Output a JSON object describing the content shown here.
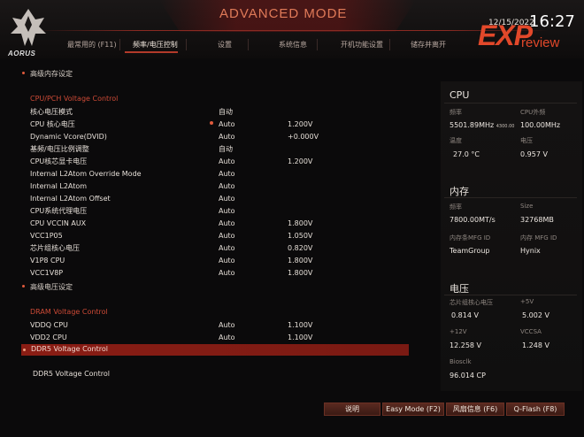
{
  "header": {
    "mode_title": "ADVANCED MODE",
    "logo_text": "AORUS",
    "date": "12/15/2022",
    "time": "16:27",
    "exp_logo": "EXP",
    "review_logo": "review",
    "tabs": [
      {
        "label": "最常用的 (F11)",
        "active": false
      },
      {
        "label": "频率/电压控制",
        "active": true
      },
      {
        "label": "设置",
        "active": false
      },
      {
        "label": "系统信息",
        "active": false
      },
      {
        "label": "开机功能设置",
        "active": false
      },
      {
        "label": "储存并离开",
        "active": false
      }
    ]
  },
  "menu": {
    "top_item": "高级内存设定",
    "cpu_section_title": "CPU/PCH Voltage Control",
    "rows": [
      {
        "label": "核心电压模式",
        "value": "自动",
        "value2": ""
      },
      {
        "label": "CPU 核心电压",
        "value": "Auto",
        "value2": "1.200V"
      },
      {
        "label": "Dynamic Vcore(DVID)",
        "value": "Auto",
        "value2": "+0.000V"
      },
      {
        "label": "基频/电压比例调整",
        "value": "自动",
        "value2": ""
      },
      {
        "label": "CPU核芯显卡电压",
        "value": "Auto",
        "value2": "1.200V"
      },
      {
        "label": "Internal L2Atom Override Mode",
        "value": "Auto",
        "value2": ""
      },
      {
        "label": "Internal L2Atom",
        "value": "Auto",
        "value2": ""
      },
      {
        "label": "Internal L2Atom Offset",
        "value": "Auto",
        "value2": ""
      },
      {
        "label": "CPU系统代理电压",
        "value": "Auto",
        "value2": ""
      },
      {
        "label": "CPU VCCIN AUX",
        "value": "Auto",
        "value2": "1.800V"
      },
      {
        "label": "VCC1P05",
        "value": "Auto",
        "value2": "1.050V"
      },
      {
        "label": "芯片组核心电压",
        "value": "Auto",
        "value2": "0.820V"
      },
      {
        "label": "V1P8 CPU",
        "value": "Auto",
        "value2": "1.800V"
      },
      {
        "label": "VCC1V8P",
        "value": "Auto",
        "value2": "1.800V"
      }
    ],
    "advanced_voltage": "高级电压设定",
    "dram_section_title": "DRAM Voltage Control",
    "dram_rows": [
      {
        "label": "VDDQ CPU",
        "value": "Auto",
        "value2": "1.100V"
      },
      {
        "label": "VDD2 CPU",
        "value": "Auto",
        "value2": "1.100V"
      }
    ],
    "ddr5_highlight": "DDR5 Voltage Control",
    "ddr5_bottom": "DDR5 Voltage Control"
  },
  "right_panel": {
    "cpu": {
      "title": "CPU",
      "freq_label": "频率",
      "freq_value": "5501.89MHz",
      "freq_sub": "4300.00",
      "ext_freq_label": "CPU外频",
      "ext_freq_value": "100.00MHz",
      "temp_label": "温度",
      "temp_value": "27.0 °C",
      "voltage_label": "电压",
      "voltage_value": "0.957 V"
    },
    "memory": {
      "title": "内存",
      "freq_label": "频率",
      "freq_value": "7800.00MT/s",
      "size_label": "Size",
      "size_value": "32768MB",
      "mfg_label": "内存条MFG ID",
      "mfg_value": "TeamGroup",
      "chip_mfg_label": "内存 MFG ID",
      "chip_mfg_value": "Hynix"
    },
    "voltage": {
      "title": "电压",
      "chipset_label": "芯片组核心电压",
      "chipset_value": "0.814 V",
      "plus5_label": "+5V",
      "plus5_value": "5.002 V",
      "plus12_label": "+12V",
      "plus12_value": "12.258 V",
      "vccsa_label": "VCCSA",
      "vccsa_value": "1.248 V",
      "biosclk_label": "Biosclk",
      "biosclk_value": "96.014 CP"
    }
  },
  "footer": {
    "help": "说明",
    "easy_mode": "Easy Mode (F2)",
    "fan": "风扇信息 (F6)",
    "qflash": "Q-Flash (F8)"
  },
  "colors": {
    "accent": "#cc4a36",
    "highlight": "#8a1d14",
    "exp_logo": "#e2482a"
  }
}
